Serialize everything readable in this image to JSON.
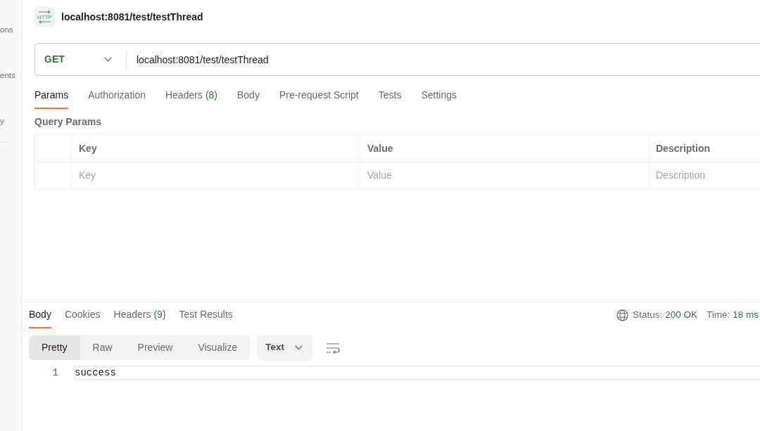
{
  "sidebar": {
    "items": [
      "ons",
      "ents",
      "y"
    ]
  },
  "request": {
    "icon_text": "HTTP",
    "title": "localhost:8081/test/testThread",
    "method": "GET",
    "url": "localhost:8081/test/testThread"
  },
  "request_tabs": [
    {
      "label": "Params",
      "selected": true
    },
    {
      "label": "Authorization",
      "selected": false
    },
    {
      "label": "Headers",
      "count": "(8)",
      "selected": false
    },
    {
      "label": "Body",
      "selected": false
    },
    {
      "label": "Pre-request Script",
      "selected": false
    },
    {
      "label": "Tests",
      "selected": false
    },
    {
      "label": "Settings",
      "selected": false
    }
  ],
  "query_params": {
    "title": "Query Params",
    "columns": [
      "Key",
      "Value",
      "Description"
    ],
    "new_row": [
      {
        "placeholder": "Key"
      },
      {
        "placeholder": "Value"
      },
      {
        "placeholder": "Description"
      }
    ]
  },
  "response": {
    "tabs": [
      {
        "label": "Body",
        "selected": true
      },
      {
        "label": "Cookies",
        "selected": false
      },
      {
        "label": "Headers",
        "count": "(9)",
        "selected": false
      },
      {
        "label": "Test Results",
        "selected": false
      }
    ],
    "status_label": "Status:",
    "status": "200 OK",
    "time_label": "Time:",
    "time": "18 ms",
    "views": [
      {
        "label": "Pretty",
        "selected": true
      },
      {
        "label": "Raw",
        "selected": false
      },
      {
        "label": "Preview",
        "selected": false
      },
      {
        "label": "Visualize",
        "selected": false
      }
    ],
    "format": "Text",
    "lines": [
      {
        "number": "1",
        "text": "success"
      }
    ]
  }
}
